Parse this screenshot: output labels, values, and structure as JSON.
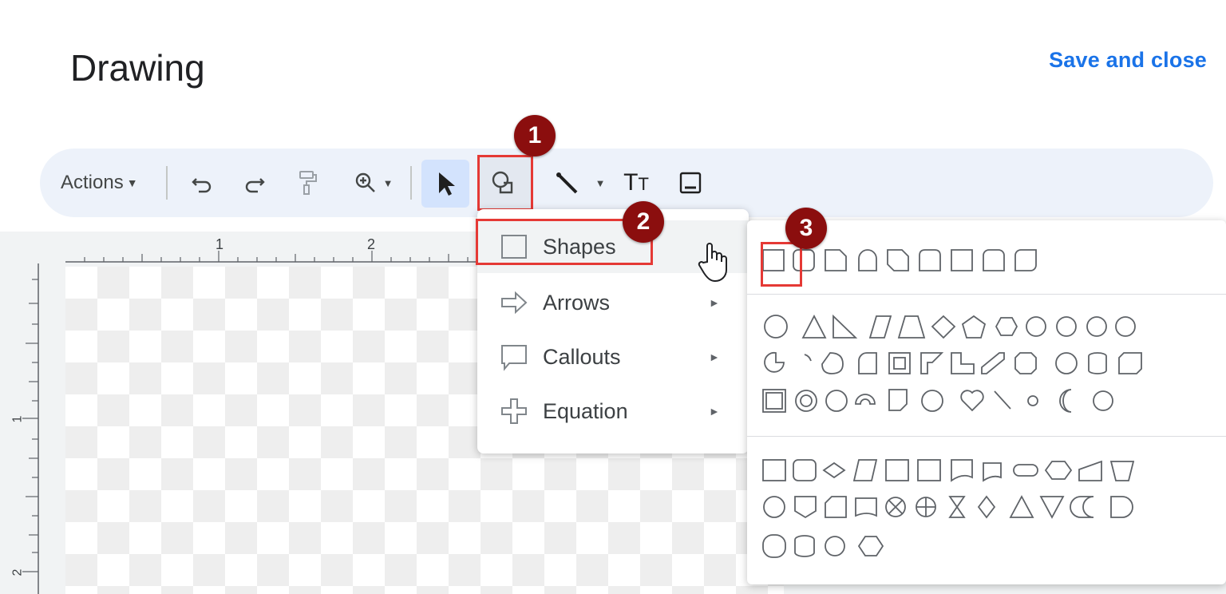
{
  "header": {
    "title": "Drawing",
    "save_label": "Save and close"
  },
  "toolbar": {
    "actions_label": "Actions",
    "icons": [
      "undo-icon",
      "redo-icon",
      "paint-format-icon",
      "zoom-icon",
      "select-icon",
      "shape-icon",
      "line-icon",
      "text-box-icon",
      "image-icon"
    ]
  },
  "ruler": {
    "top_marks": [
      "1",
      "2"
    ],
    "left_marks": [
      "1",
      "2"
    ]
  },
  "menu": {
    "items": [
      {
        "label": "Shapes",
        "icon": "square-icon"
      },
      {
        "label": "Arrows",
        "icon": "arrow-icon"
      },
      {
        "label": "Callouts",
        "icon": "callout-icon"
      },
      {
        "label": "Equation",
        "icon": "plus-icon"
      }
    ]
  },
  "badges": [
    "1",
    "2",
    "3"
  ],
  "colors": {
    "accent": "#1a73e8",
    "badge": "#8b0e0e",
    "highlight": "#e53935",
    "toolbar_bg": "#edf2fa"
  }
}
